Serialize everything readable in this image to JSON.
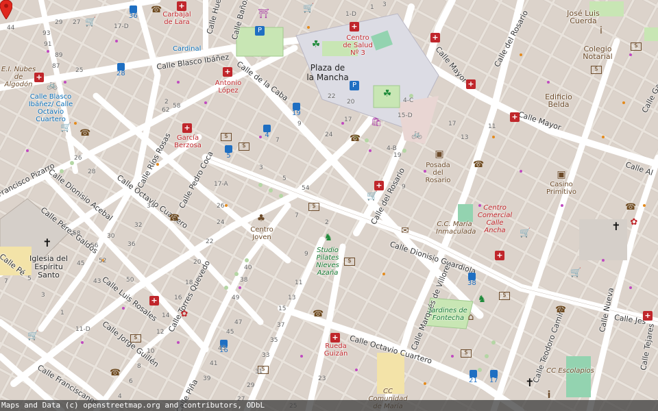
{
  "streets": [
    {
      "id": "calle-blasco-ibanez",
      "name": "Calle Blasco Ibáñez"
    },
    {
      "id": "calle-de-la-caba",
      "name": "Calle de la Caba"
    },
    {
      "id": "calle-banos",
      "name": "Calle Baños"
    },
    {
      "id": "calle-huerta",
      "name": "Calle Huerta"
    },
    {
      "id": "calle-mayor-1",
      "name": "Calle Mayor"
    },
    {
      "id": "calle-mayor-2",
      "name": "Calle Mayor"
    },
    {
      "id": "calle-del-rosario-1",
      "name": "Calle del Rosario"
    },
    {
      "id": "calle-del-rosario-2",
      "name": "Calle del Rosario"
    },
    {
      "id": "calle-rios-rosas",
      "name": "Calle Ríos Rosas"
    },
    {
      "id": "calle-pedro-coca",
      "name": "Calle Pedro Coca"
    },
    {
      "id": "francisco-pizarro",
      "name": "Francisco Pizarro"
    },
    {
      "id": "calle-dionisio-acebal",
      "name": "Calle Dionisio Acebal"
    },
    {
      "id": "calle-octavio-cuartero-1",
      "name": "Calle Octavio Cuartero"
    },
    {
      "id": "calle-octavio-cuartero-2",
      "name": "Calle Octavio Cuartero"
    },
    {
      "id": "calle-perez-galdos",
      "name": "Calle Pérez Galdós"
    },
    {
      "id": "calle-dionisio-guardiola",
      "name": "Calle Dionisio Guardiola"
    },
    {
      "id": "calle-marques-de-villores",
      "name": "Calle Marqués de Villores"
    },
    {
      "id": "calle-luis-rosales",
      "name": "Calle Luis Rosales"
    },
    {
      "id": "calle-torres-quevedo",
      "name": "Calle Torres Quevedo"
    },
    {
      "id": "calle-jorge-guillen",
      "name": "Calle Jorge Guillén"
    },
    {
      "id": "calle-franciscanos",
      "name": "Calle Franciscanos"
    },
    {
      "id": "calle-teodoro-camino",
      "name": "Calle Teodoro Camino"
    },
    {
      "id": "calle-nueva",
      "name": "Calle Nueva"
    },
    {
      "id": "calle-tejares",
      "name": "Calle Tejares"
    },
    {
      "id": "calle-jes",
      "name": "Calle Jes"
    },
    {
      "id": "calle-gaona",
      "name": "Calle Gaona"
    },
    {
      "id": "calle-alta",
      "name": "Calle Al"
    },
    {
      "id": "calle-pina",
      "name": "Calle Piña"
    },
    {
      "id": "calle-pc",
      "name": "Calle Pé"
    }
  ],
  "places": {
    "carbajal_de_lara": "Carbajal de Lara",
    "cardinal": "Cardinal",
    "centro_de_salud": "Centro de Salud Nº 3",
    "plaza_de_la_mancha": "Plaza de la Mancha",
    "antonio_lopez": "Antonio López",
    "garcia_berzosa": "García Berzosa",
    "calle_blasco_ibanez_bike": "Calle Blasco Ibáñez/ Calle Octavio Cuartero",
    "el_nubes": "E.I. Nubes de Algodón",
    "centro_joven": "Centro Joven",
    "studio_pilates": "Studio Pilates Nieves Azaña",
    "posada_del_rosario": "Posada del Rosario",
    "casino_primitivo": "Casino Primitivo",
    "centro_comercial": "Centro Comercial Calle Ancha",
    "cc_maria_inmaculada": "C.C. María Inmaculada",
    "jardines_de_fontecha": "Jardines de Fontecha",
    "rueda_guizan": "Rueda Guizán",
    "iglesia_espiritu_santo": "Iglesia del Espíritu Santo",
    "edificio_belda": "Edificio Belda",
    "colegio_notarial": "Colegio Notarial",
    "jose_luis_cuerda": "José Luis Cuerda",
    "cc_escolapios": "CC Escolapios",
    "cc_comunidad_de_maria": "CC Comunidad de María"
  },
  "bus_stops": [
    {
      "id": "bus-36",
      "label": "36"
    },
    {
      "id": "bus-28",
      "label": "28"
    },
    {
      "id": "bus-19",
      "label": "19"
    },
    {
      "id": "bus-4",
      "label": "4"
    },
    {
      "id": "bus-5",
      "label": "5"
    },
    {
      "id": "bus-38",
      "label": "38"
    },
    {
      "id": "bus-16",
      "label": "16"
    },
    {
      "id": "bus-21",
      "label": "21"
    },
    {
      "id": "bus-17",
      "label": "17"
    }
  ],
  "house_numbers": [
    "29",
    "27",
    "93",
    "91",
    "89",
    "87",
    "17-D",
    "25",
    "44",
    "7",
    "2",
    "9",
    "1",
    "3",
    "1-D",
    "3",
    "5",
    "7",
    "9",
    "11",
    "13",
    "15",
    "17",
    "17-A",
    "26",
    "24",
    "22",
    "20",
    "18",
    "16",
    "14",
    "12",
    "10",
    "8",
    "6",
    "4",
    "2",
    "62",
    "58",
    "54",
    "45",
    "43",
    "40",
    "38",
    "36",
    "34",
    "32",
    "30",
    "28",
    "26",
    "24",
    "22",
    "20",
    "15-D",
    "4-C",
    "4-B",
    "19",
    "17",
    "13",
    "11",
    "9",
    "7",
    "5",
    "3",
    "1",
    "11-D",
    "50",
    "52",
    "56",
    "58",
    "49",
    "47",
    "45",
    "43",
    "41",
    "39",
    "37",
    "35",
    "33",
    "31",
    "29",
    "27",
    "25",
    "23",
    "21",
    "19",
    "69",
    "37"
  ],
  "attribution": "Maps and Data (c) openstreetmap.org and contributors, ODbL",
  "colors": {
    "background": "#e9e3dc",
    "building": "#d9d0c9",
    "road": "#ffffff",
    "park": "#c8facc",
    "pedestrian": "#dddde8",
    "pin": "#e0281e"
  },
  "icons": [
    "hospital-icon",
    "bus-stop-icon",
    "parking-icon",
    "bicycle-icon",
    "shop-icon",
    "bank-icon",
    "phone-icon",
    "church-icon",
    "theatre-icon",
    "post-icon",
    "museum-icon",
    "playground-icon",
    "pharmacy-icon",
    "info-icon",
    "marker-pin-icon"
  ]
}
